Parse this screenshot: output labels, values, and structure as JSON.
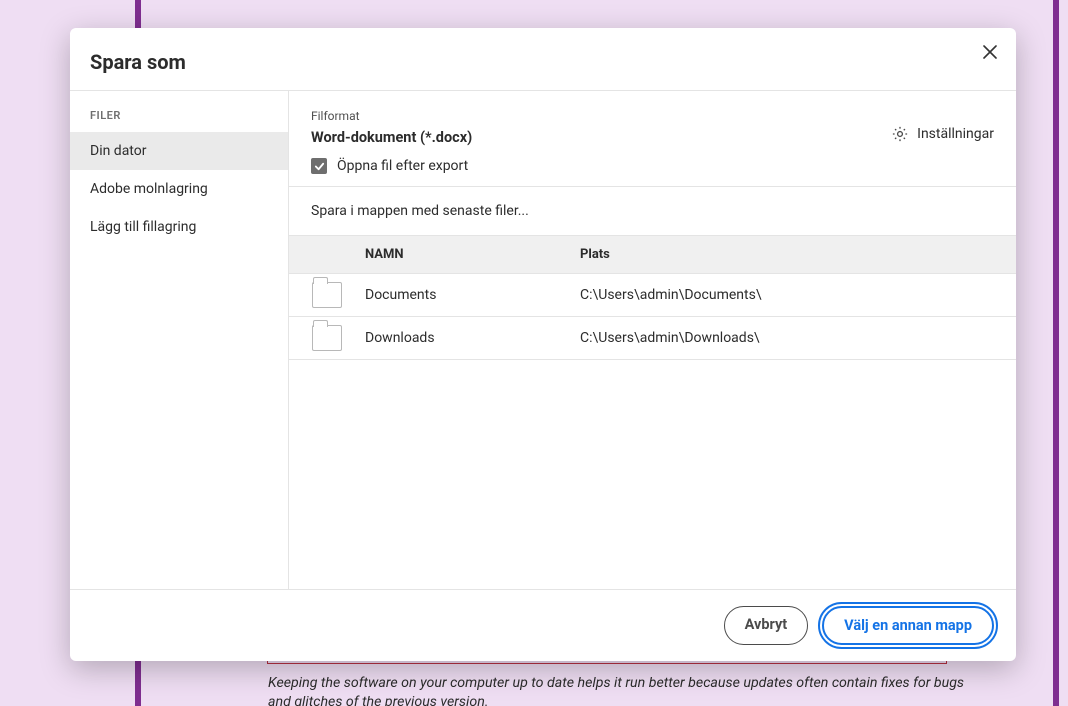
{
  "background": {
    "tip_text": "Keeping the software on your computer up to date helps it run better because updates often contain fixes for bugs and glitches of the previous version."
  },
  "dialog": {
    "title": "Spara som",
    "close_aria": "Stäng",
    "sidebar": {
      "section_label": "FILER",
      "items": [
        {
          "label": "Din dator",
          "active": true
        },
        {
          "label": "Adobe molnlagring",
          "active": false
        },
        {
          "label": "Lägg till fillagring",
          "active": false
        }
      ]
    },
    "format": {
      "caption": "Filformat",
      "value": "Word-dokument (*.docx)",
      "open_after_export_label": "Öppna fil efter export",
      "open_after_export_checked": true,
      "settings_label": "Inställningar"
    },
    "recent": {
      "caption": "Spara i mappen med senaste filer...",
      "columns": {
        "name": "NAMN",
        "path": "Plats"
      },
      "rows": [
        {
          "name": "Documents",
          "path": "C:\\Users\\admin\\Documents\\"
        },
        {
          "name": "Downloads",
          "path": "C:\\Users\\admin\\Downloads\\"
        }
      ]
    },
    "footer": {
      "cancel": "Avbryt",
      "choose": "Välj en annan mapp"
    }
  }
}
